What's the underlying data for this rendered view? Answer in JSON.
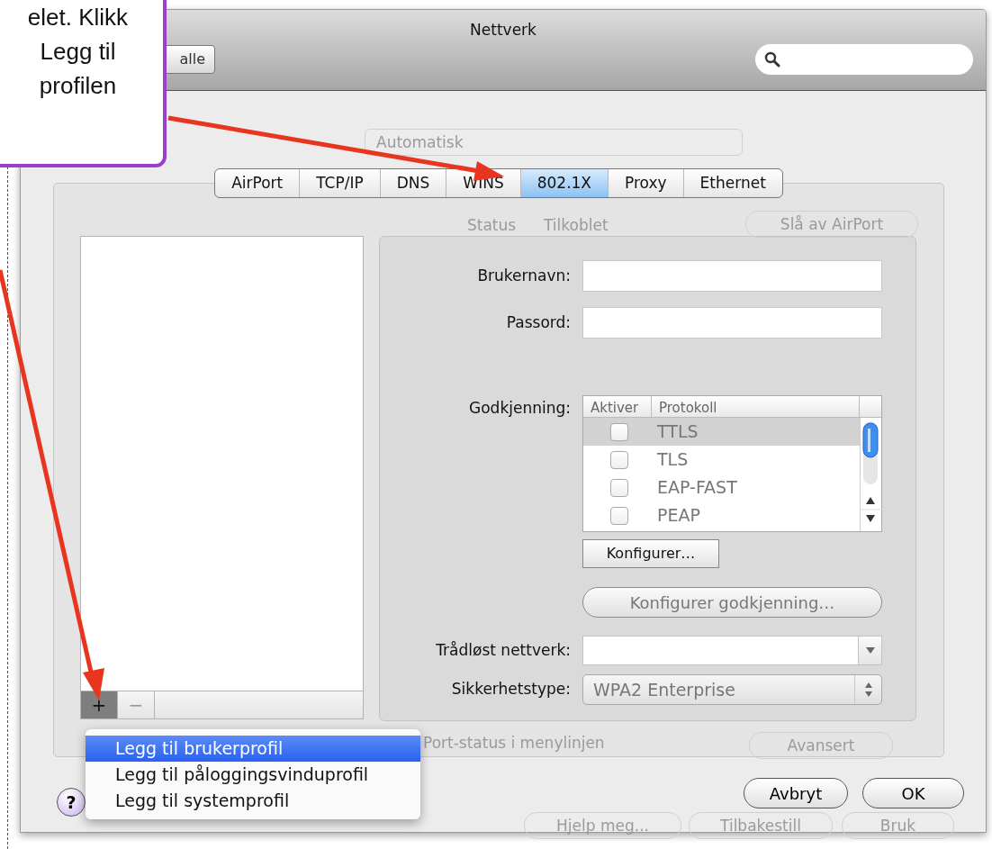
{
  "window": {
    "title": "Nettverk",
    "back_button": "alle"
  },
  "behind_sheet": {
    "location_value": "Automatisk",
    "status_label": "Status",
    "status_value": "Tilkoblet",
    "turn_off_button": "Slå av AirPort",
    "menu_bar_option": "Port-status i menylinjen",
    "advanced_button": "Avansert",
    "assist_button": "Hjelp meg...",
    "revert_button": "Tilbakestill",
    "apply_button": "Bruk"
  },
  "tabs": [
    {
      "label": "AirPort",
      "selected": false
    },
    {
      "label": "TCP/IP",
      "selected": false
    },
    {
      "label": "DNS",
      "selected": false
    },
    {
      "label": "WINS",
      "selected": false
    },
    {
      "label": "802.1X",
      "selected": true
    },
    {
      "label": "Proxy",
      "selected": false
    },
    {
      "label": "Ethernet",
      "selected": false
    }
  ],
  "profiles": {
    "add_button": {
      "label": "+",
      "pressed": true
    },
    "remove_button": {
      "label": "−",
      "pressed": false
    },
    "menu": [
      {
        "label": "Legg til brukerprofil",
        "selected": true
      },
      {
        "label": "Legg til påloggingsvinduprofil",
        "selected": false
      },
      {
        "label": "Legg til systemprofil",
        "selected": false
      }
    ]
  },
  "form": {
    "username_label": "Brukernavn:",
    "password_label": "Passord:",
    "auth_label": "Godkjenning:",
    "auth_table": {
      "columns": [
        "Aktiver",
        "Protokoll"
      ],
      "disabled": true,
      "rows": [
        {
          "protocol": "TTLS",
          "checked": false,
          "selected": true
        },
        {
          "protocol": "TLS",
          "checked": false,
          "selected": false
        },
        {
          "protocol": "EAP-FAST",
          "checked": false,
          "selected": false
        },
        {
          "protocol": "PEAP",
          "checked": false,
          "selected": false
        }
      ]
    },
    "configure_button": {
      "label": "Konfigurer…",
      "disabled": false
    },
    "configure_auth_button": {
      "label": "Konfigurer godkjenning…",
      "disabled": true
    },
    "wireless_label": "Trådløst nettverk:",
    "security_label": "Sikkerhetstype:",
    "security_popup": {
      "value": "WPA2 Enterprise",
      "disabled": true
    }
  },
  "help_button": "?",
  "buttons": [
    "Avbryt",
    "OK"
  ],
  "callout": {
    "lines": [
      "elet. Klikk",
      "Legg til",
      "profilen"
    ]
  }
}
